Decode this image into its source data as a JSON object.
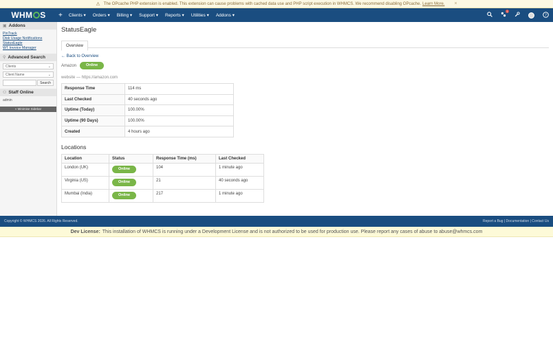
{
  "warning": {
    "text": "The OPcache PHP extension is enabled. This extension can cause problems with cached data use and PHP script execution in WHMCS. We recommend disabling OPcache.",
    "link": "Learn More.",
    "close": "×"
  },
  "nav": {
    "brand": {
      "pre": "WHM",
      "post": "S"
    },
    "plus": "+",
    "items": [
      "Clients ▾",
      "Orders ▾",
      "Billing ▾",
      "Support ▾",
      "Reports ▾",
      "Utilities ▾",
      "Addons ▾"
    ],
    "notification_count": "1"
  },
  "sidebar": {
    "addons_title": "Addons",
    "addon_links": [
      "PinTrack",
      "Disk Usage Notifications",
      "StatusEagle",
      "WT Invoice Manager"
    ],
    "search_title": "Advanced Search",
    "select_clients": "Clients",
    "select_field": "Client Name",
    "search_button": "Search",
    "staff_title": "Staff Online",
    "staff_name": "admin",
    "minimize": "« Minimise Sidebar"
  },
  "main": {
    "title": "StatusEagle",
    "tab": "Overview",
    "back": "← Back to Overview",
    "monitor_name": "Amazon",
    "monitor_status": "Online",
    "monitor_url": "website — https://amazon.com",
    "info": [
      {
        "k": "Response Time",
        "v": "114 ms"
      },
      {
        "k": "Last Checked",
        "v": "40 seconds ago"
      },
      {
        "k": "Uptime (Today)",
        "v": "100.00%"
      },
      {
        "k": "Uptime (90 Days)",
        "v": "100.00%"
      },
      {
        "k": "Created",
        "v": "4 hours ago"
      }
    ],
    "locations_title": "Locations",
    "loc_headers": [
      "Location",
      "Status",
      "Response Time (ms)",
      "Last Checked"
    ],
    "locations": [
      {
        "location": "London (UK)",
        "status": "Online",
        "rt": "104",
        "checked": "1 minute ago"
      },
      {
        "location": "Virginia (US)",
        "status": "Online",
        "rt": "21",
        "checked": "40 seconds ago"
      },
      {
        "location": "Mumbai (India)",
        "status": "Online",
        "rt": "217",
        "checked": "1 minute ago"
      }
    ]
  },
  "footer": {
    "copyright": "Copyright © WHMCS 2026. All Rights Reserved.",
    "links": [
      "Report a Bug",
      "Documentation",
      "Contact Us"
    ]
  },
  "dev": {
    "label": "Dev License:",
    "text": "This installation of WHMCS is running under a Development License and is not authorized to be used for production use. Please report any cases of abuse to abuse@whmcs.com"
  },
  "colors": {
    "navbar": "#1a4d80",
    "online": "#7ab648",
    "warning_bg": "#fcf8e3"
  }
}
